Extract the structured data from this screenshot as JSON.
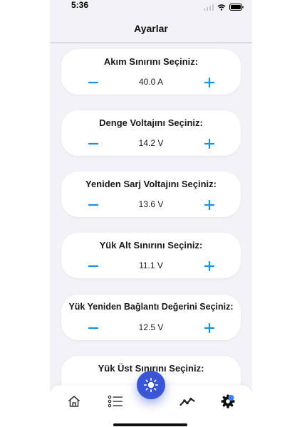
{
  "status_bar": {
    "time": "5:36"
  },
  "nav": {
    "title": "Ayarlar"
  },
  "settings": [
    {
      "title": "Akım Sınırını Seçiniz:",
      "value": "40.0 A"
    },
    {
      "title": "Denge Voltajını Seçiniz:",
      "value": "14.2 V"
    },
    {
      "title": "Yeniden Sarj Voltajını Seçiniz:",
      "value": "13.6 V"
    },
    {
      "title": "Yük Alt Sınırını Seçiniz:",
      "value": "11.1 V"
    },
    {
      "title": "Yük Yeniden Bağlantı Değerini Seçiniz:",
      "value": "12.5 V"
    },
    {
      "title": "Yük Üst Sınırını Seçiniz:",
      "value": ""
    }
  ],
  "tabbar": {
    "items": [
      "home-icon",
      "list-icon",
      "brightness-icon",
      "chart-line-icon",
      "settings-icon"
    ],
    "active": "settings-icon"
  },
  "colors": {
    "accent": "#1f8fe0",
    "fab": "#3b55d9",
    "background": "#f2f2f7",
    "card": "#ffffff"
  }
}
